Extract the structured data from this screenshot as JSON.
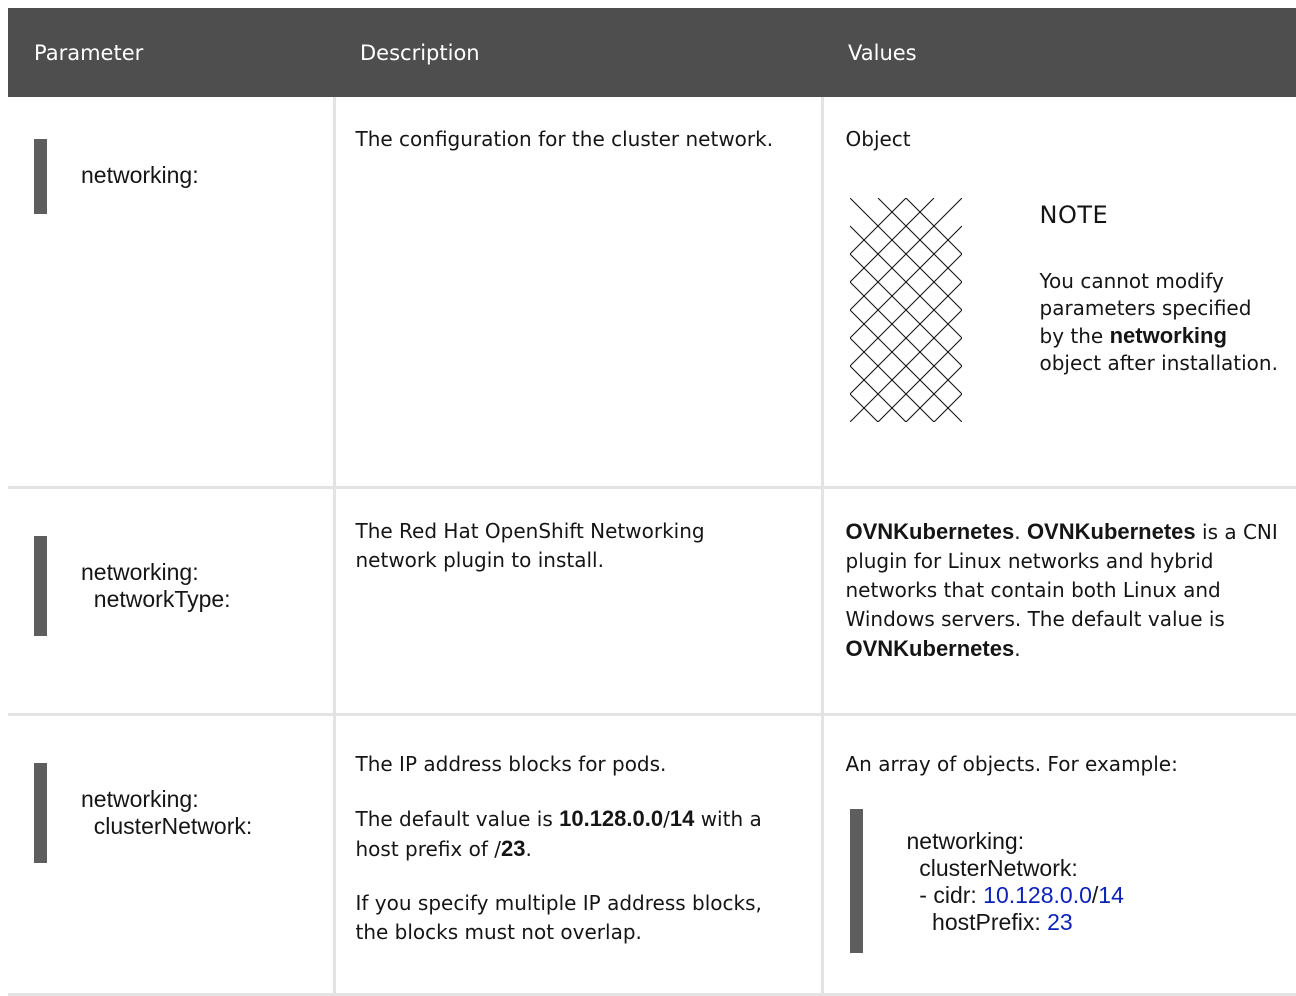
{
  "table": {
    "headers": {
      "parameter": "Parameter",
      "description": "Description",
      "values": "Values"
    },
    "rows": [
      {
        "param_lines": [
          "networking:"
        ],
        "description": "The configuration for the cluster network.",
        "value_text": "Object",
        "note": {
          "title": "NOTE",
          "text_before": "You cannot modify parameters specified by the",
          "text_bold": "networking",
          "text_after": "object after installation."
        }
      },
      {
        "param_lines": [
          "networking:",
          "  networkType:"
        ],
        "description": "The Red Hat OpenShift Networking network plugin to install.",
        "value": {
          "bold1": "OVNKubernetes",
          "sep": ".",
          "bold2": "OVNKubernetes",
          "text": "is a CNI plugin for Linux networks and hybrid networks that contain both Linux and Windows servers. The default value is",
          "bold3": "OVNKubernetes",
          "end": "."
        }
      },
      {
        "param_lines": [
          "networking:",
          "  clusterNetwork:"
        ],
        "description": {
          "p1": "The IP address blocks for pods.",
          "p2_before": "The default value is",
          "p2_bold1": "10.128.0.0",
          "p2_slash": "/",
          "p2_bold2": "14",
          "p2_mid": "with a host prefix of /",
          "p2_bold3": "23",
          "p2_end": ".",
          "p3": "If you specify multiple IP address blocks, the blocks must not overlap."
        },
        "value_text": "An array of objects. For example:",
        "example": {
          "l1": "networking:",
          "l2": "  clusterNetwork:",
          "l3_key": "  - cidr: ",
          "l3_ip": "10.128.0.0",
          "l3_slash": "/",
          "l3_mask": "14",
          "l4_key": "    hostPrefix: ",
          "l4_val": "23"
        }
      }
    ]
  },
  "colors": {
    "header_bg": "#4e4e4e",
    "code_bar": "#5e5e5e",
    "grid_line": "#e3e3e3",
    "number": "#0d22b8"
  },
  "icons": {
    "note": "diamond-lattice-pattern-icon"
  }
}
